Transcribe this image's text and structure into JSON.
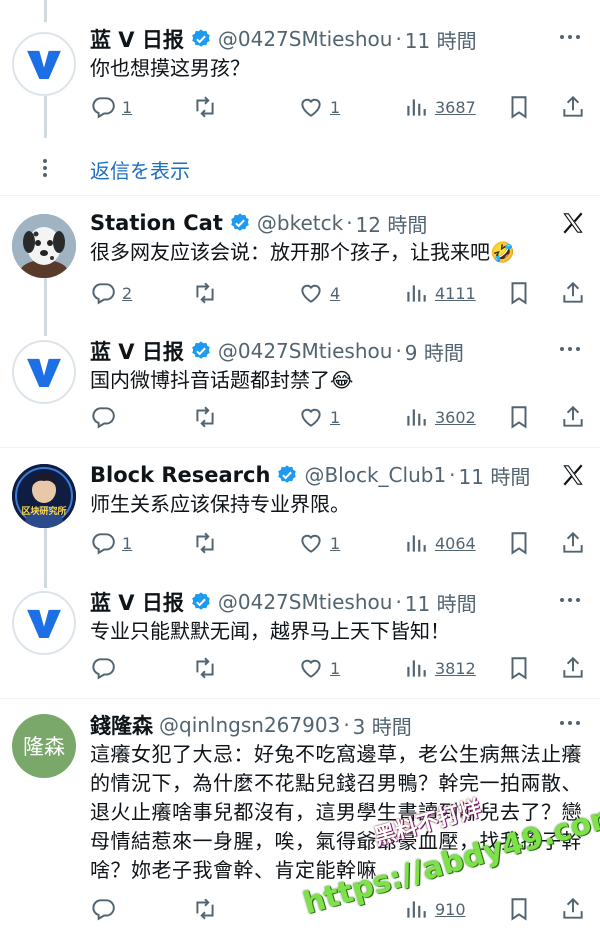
{
  "tweets": [
    {
      "name": "蓝 V 日报",
      "handle": "@0427SMtieshou",
      "time": "11 時間",
      "text": "你也想摸这男孩？",
      "replies": "1",
      "retweets": "",
      "likes": "1",
      "views": "3687",
      "avatar": "blue-v-avatar",
      "corner": "more"
    },
    {
      "name": "Station Cat",
      "handle": "@bketck",
      "time": "12 時間",
      "text": "很多网友应该会说：放开那个孩子，让我来吧🤣",
      "replies": "2",
      "retweets": "",
      "likes": "4",
      "views": "4111",
      "avatar": "dalmatian-avatar",
      "corner": "x"
    },
    {
      "name": "蓝 V 日报",
      "handle": "@0427SMtieshou",
      "time": "9 時間",
      "text": "国内微博抖音话题都封禁了😂",
      "replies": "",
      "retweets": "",
      "likes": "1",
      "views": "3602",
      "avatar": "blue-v-avatar",
      "corner": "more"
    },
    {
      "name": "Block Research",
      "handle": "@Block_Club1",
      "time": "11 時間",
      "text": "师生关系应该保持专业界限。",
      "replies": "1",
      "retweets": "",
      "likes": "1",
      "views": "4064",
      "avatar": "block-research-avatar",
      "corner": "x",
      "avatar_text": "区块研究所"
    },
    {
      "name": "蓝 V 日报",
      "handle": "@0427SMtieshou",
      "time": "11 時間",
      "text": "专业只能默默无闻，越界马上天下皆知！",
      "replies": "",
      "retweets": "",
      "likes": "1",
      "views": "3812",
      "avatar": "blue-v-avatar",
      "corner": "more"
    },
    {
      "name": "錢隆森",
      "handle": "@qinlngsn267903",
      "time": "3 時間",
      "text": "這癢女犯了大忌：好兔不吃窩邊草，老公生病無法止癢的情況下，為什麼不花點兒錢召男鴨？幹完一拍兩散、退火止癢啥事兒都沒有，這男學生書讀到哪兒去了？戀母情結惹來一身腥，唉，氣得爺爺豪血壓，找我孫子幹啥？妳老子我會幹、肯定能幹嘛",
      "replies": "",
      "retweets": "",
      "likes": "",
      "views": "910",
      "avatar": "text-avatar",
      "corner": "more",
      "avatar_text": "隆森"
    }
  ],
  "show_replies_label": "返信を表示",
  "watermark_url": "https://abdy49.com",
  "watermark_title": "黑料不打烊",
  "colors": {
    "blue_v": "#1d6fe6",
    "link": "#1d6fc4",
    "muted": "#536471",
    "verified": "#1d9bf0",
    "avatar_green": "#7aa86a"
  }
}
